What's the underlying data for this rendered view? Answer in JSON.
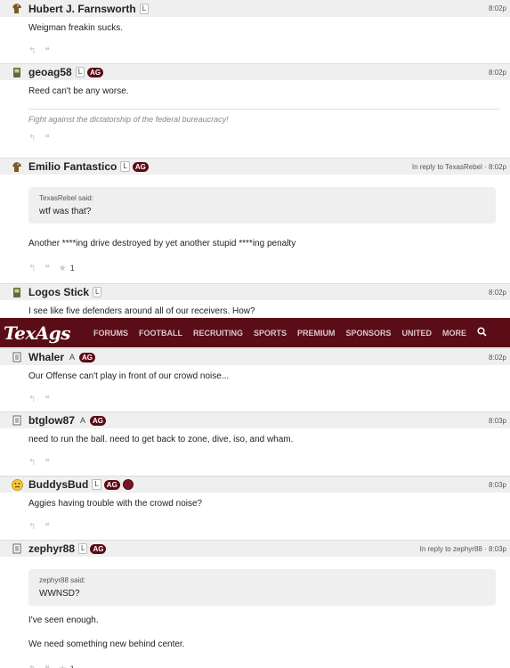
{
  "nav": {
    "logo": "TexAgs",
    "items": [
      "FORUMS",
      "FOOTBALL",
      "RECRUITING",
      "SPORTS",
      "PREMIUM",
      "SPONSORS",
      "UNITED",
      "MORE"
    ]
  },
  "colors": {
    "brand": "#5a0d17",
    "badge_ag": "#5c0a16",
    "header_bg": "#efefef"
  },
  "posts": [
    {
      "avatar_icon": "horse-icon",
      "username": "Hubert J. Farnsworth",
      "badges": [
        "L"
      ],
      "time": "8:02p",
      "text": "Weigman freakin sucks."
    },
    {
      "avatar_icon": "phone-icon",
      "username": "geoag58",
      "badges": [
        "L",
        "AG"
      ],
      "time": "8:02p",
      "text": "Reed can't be any worse.",
      "signature": "Fight against the dictatorship of the federal bureaucracy!"
    },
    {
      "avatar_icon": "horse-icon",
      "username": "Emilio Fantastico",
      "badges": [
        "L",
        "AG"
      ],
      "time": "In reply to TexasRebel · 8:02p",
      "quote_author": "TexasRebel said:",
      "quote_text": "wtf was that?",
      "text": "Another ****ing drive destroyed by yet another stupid ****ing penalty",
      "star_count": "1"
    },
    {
      "avatar_icon": "phone-icon",
      "username": "Logos Stick",
      "badges": [
        "L"
      ],
      "time": "8:02p",
      "text": "I see like five defenders around all of our receivers. How?"
    },
    {
      "avatar_icon": "doc-icon",
      "username": "Whaler",
      "badges": [
        "A",
        "AG"
      ],
      "time": "8:02p",
      "text": "Our Offense can't play in front of our crowd noise..."
    },
    {
      "avatar_icon": "doc-icon",
      "username": "btglow87",
      "badges": [
        "A",
        "AG"
      ],
      "time": "8:03p",
      "text": "need to run the ball. need to get back to zone, dive, iso, and wham."
    },
    {
      "avatar_icon": "smiley-icon",
      "username": "BuddysBud",
      "badges": [
        "L",
        "AG"
      ],
      "time": "8:03p",
      "text": "Aggies having trouble with the crowd noise?"
    },
    {
      "avatar_icon": "doc-icon",
      "username": "zephyr88",
      "badges": [
        "L",
        "AG"
      ],
      "time": "In reply to zephyr88 · 8:03p",
      "quote_author": "zephyr88 said:",
      "quote_text": "WWNSD?",
      "text": "I've seen enough.",
      "text2": "We need something new behind center.",
      "star_count": "1"
    }
  ]
}
